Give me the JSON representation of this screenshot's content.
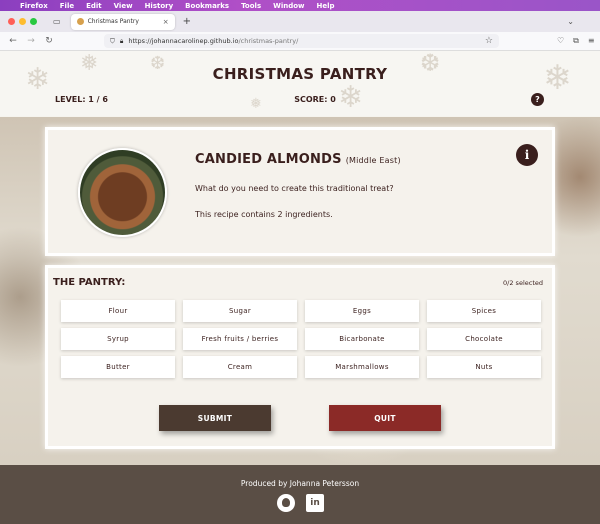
{
  "menubar": {
    "apple": "",
    "items": [
      "Firefox",
      "File",
      "Edit",
      "View",
      "History",
      "Bookmarks",
      "Tools",
      "Window",
      "Help"
    ]
  },
  "browser": {
    "tab_title": "Christmas Pantry",
    "url_domain": "https://johannacarolinep.github.io",
    "url_path": "/christmas-pantry/",
    "icons": [
      "back-arrow-icon",
      "forward-arrow-icon",
      "reload-icon",
      "shield-icon",
      "lock-icon",
      "star-icon",
      "pocket-icon",
      "extensions-icon",
      "menu-icon"
    ]
  },
  "header": {
    "title": "CHRISTMAS PANTRY",
    "level": "LEVEL: 1 / 6",
    "score": "SCORE: 0",
    "help": "?"
  },
  "recipe": {
    "name": "CANDIED ALMONDS",
    "origin": "(Middle East)",
    "question": "What do you need to create this traditional treat?",
    "ingredients_count": "This recipe contains 2 ingredients.",
    "info": "i"
  },
  "pantry": {
    "title": "THE PANTRY:",
    "selected": "0/2 selected",
    "ingredients": [
      "Flour",
      "Sugar",
      "Eggs",
      "Spices",
      "Syrup",
      "Fresh fruits / berries",
      "Bicarbonate",
      "Chocolate",
      "Butter",
      "Cream",
      "Marshmallows",
      "Nuts"
    ],
    "submit": "SUBMIT",
    "quit": "QUIT"
  },
  "footer": {
    "credit": "Produced by Johanna Petersson",
    "linkedin": "in"
  },
  "colors": {
    "brand_dark": "#3a1f1d",
    "submit": "#4b3a30",
    "quit": "#8b2a27",
    "footer": "#5a4e45"
  }
}
